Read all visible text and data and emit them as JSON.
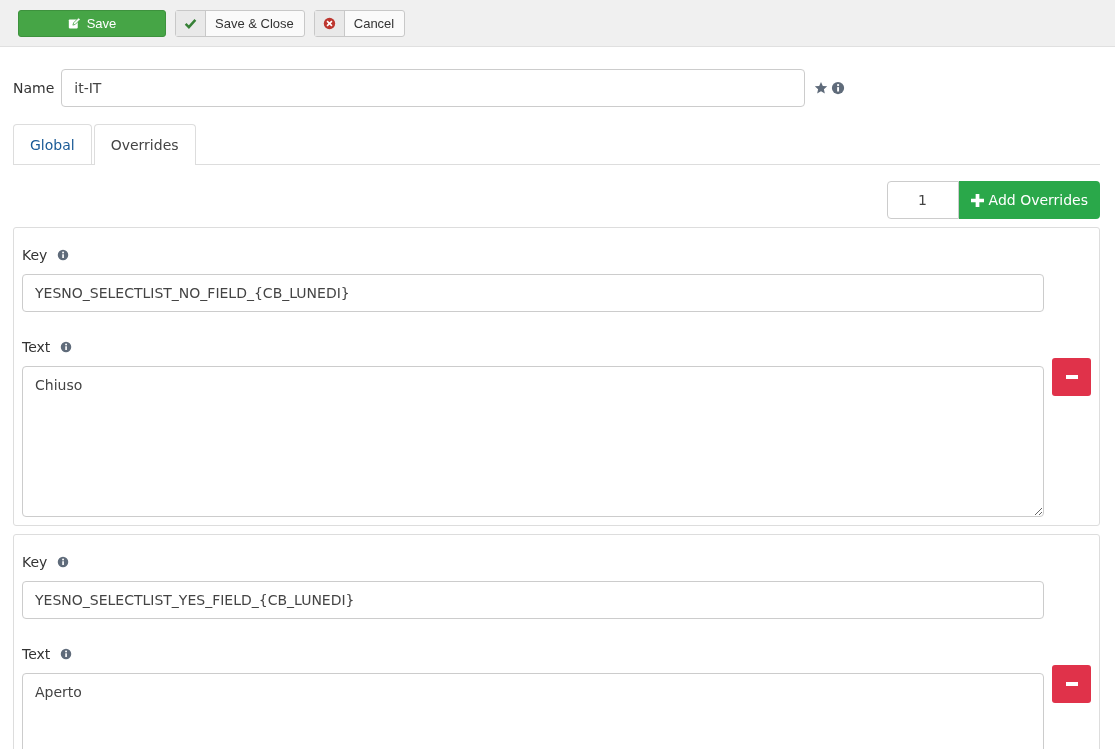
{
  "toolbar": {
    "buttons": [
      {
        "label": "Save",
        "kind": "primary"
      },
      {
        "label": "Save & Close",
        "kind": "check"
      },
      {
        "label": "Cancel",
        "kind": "cancel"
      }
    ]
  },
  "name_field": {
    "label": "Name",
    "value": "it-IT"
  },
  "tabs": [
    {
      "label": "Global",
      "selected": false
    },
    {
      "label": "Overrides",
      "selected": true
    }
  ],
  "add_overrides": {
    "count": "1",
    "button": "Add Overrides"
  },
  "overrides": [
    {
      "key_label": "Key",
      "key": "YESNO_SELECTLIST_NO_FIELD_{CB_LUNEDI}",
      "text_label": "Text",
      "text": "Chiuso"
    },
    {
      "key_label": "Key",
      "key": "YESNO_SELECTLIST_YES_FIELD_{CB_LUNEDI}",
      "text_label": "Text",
      "text": "Aperto"
    }
  ]
}
